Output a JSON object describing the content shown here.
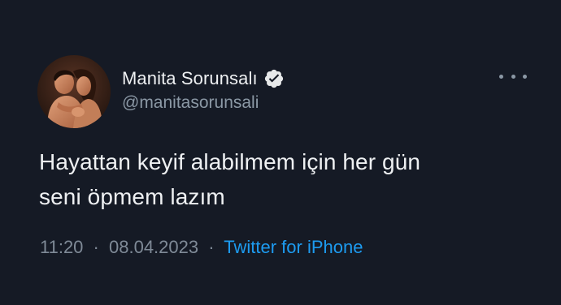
{
  "tweet": {
    "author": {
      "display_name": "Manita Sorunsalı",
      "handle": "@manitasorunsali",
      "verified": true,
      "avatar_icon": "couple-photo-avatar"
    },
    "text_line1": "Hayattan keyif alabilmem için her gün",
    "text_line2": "seni öpmem lazım",
    "time": "11:20",
    "separator": "·",
    "date": "08.04.2023",
    "source": "Twitter for iPhone",
    "more_icon": "more-horizontal-icon"
  },
  "colors": {
    "background": "#151a25",
    "text": "#eef0f2",
    "secondary": "#8b98a5",
    "link": "#1d9bf0"
  }
}
